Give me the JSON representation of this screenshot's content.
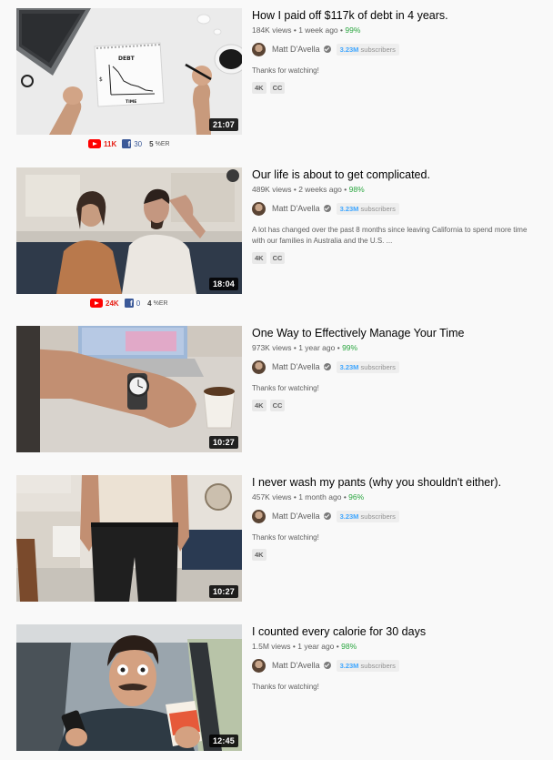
{
  "channel": {
    "name": "Matt D'Avella",
    "subs_count": "3.23M",
    "subs_label": "subscribers"
  },
  "videos": [
    {
      "title": "How I paid off $117k of debt in 4 years.",
      "views": "184K views",
      "age": "1 week ago",
      "rating": "99%",
      "description": "Thanks for watching!",
      "badges": [
        "4K",
        "CC"
      ],
      "duration": "21:07",
      "thumb_icons": [
        "laptop",
        "notebook-debt-graph",
        "hands",
        "coffee-cup"
      ],
      "thumb_text": {
        "top": "DEBT",
        "bottom": "TIME",
        "axis": "$"
      },
      "social": {
        "youtube": "11K",
        "facebook": "30",
        "er_value": "5",
        "er_label": "%ER"
      }
    },
    {
      "title": "Our life is about to get complicated.",
      "views": "489K views",
      "age": "2 weeks ago",
      "rating": "98%",
      "description": "A lot has changed over the past 8 months since leaving California to spend more time with our families in Australia and the U.S. ...",
      "badges": [
        "4K",
        "CC"
      ],
      "duration": "18:04",
      "thumb_icons": [
        "couple-on-couch"
      ],
      "social": {
        "youtube": "24K",
        "facebook": "0",
        "er_value": "4",
        "er_label": "%ER"
      }
    },
    {
      "title": "One Way to Effectively Manage Your Time",
      "views": "973K views",
      "age": "1 year ago",
      "rating": "99%",
      "description": "Thanks for watching!",
      "badges": [
        "4K",
        "CC"
      ],
      "duration": "10:27",
      "thumb_icons": [
        "wristwatch",
        "laptop",
        "coffee-cup"
      ]
    },
    {
      "title": "I never wash my pants (why you shouldn't either).",
      "views": "457K views",
      "age": "1 month ago",
      "rating": "96%",
      "description": "Thanks for watching!",
      "badges": [
        "4K"
      ],
      "duration": "10:27",
      "thumb_icons": [
        "man-in-jeans"
      ]
    },
    {
      "title": "I counted every calorie for 30 days",
      "views": "1.5M views",
      "age": "1 year ago",
      "rating": "98%",
      "description": "Thanks for watching!",
      "badges": [],
      "duration": "12:45",
      "thumb_icons": [
        "man-in-car",
        "phone",
        "snack-bag"
      ]
    }
  ],
  "colors": {
    "background": "#f9f9f9",
    "rating_green": "#2ba640",
    "subs_blue": "#3ea6ff",
    "youtube_red": "#ff0000",
    "facebook_blue": "#3b5998"
  }
}
